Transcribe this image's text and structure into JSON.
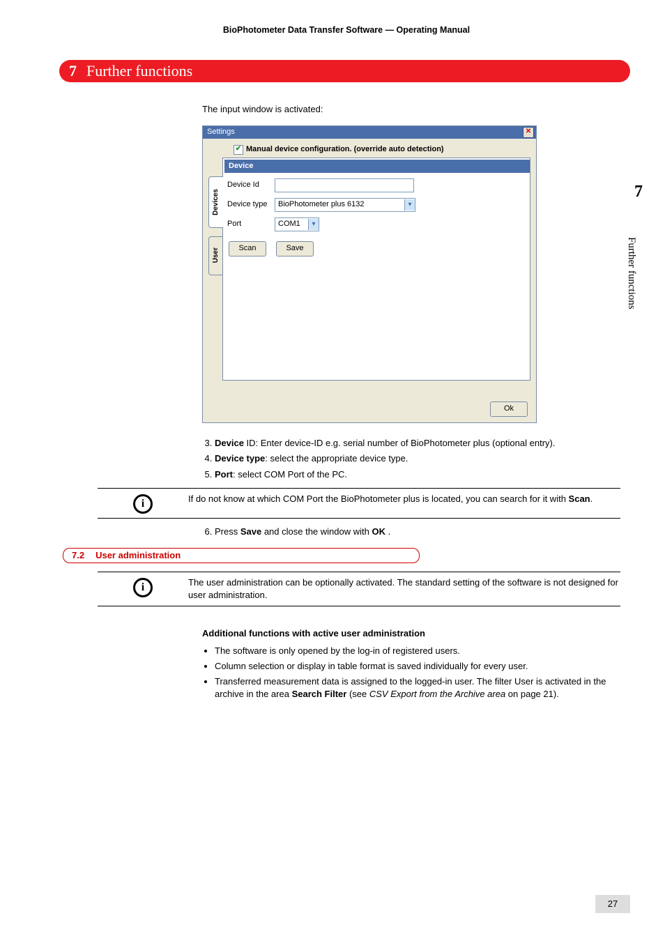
{
  "header": {
    "doc_title": "BioPhotometer Data Transfer Software  —  Operating Manual"
  },
  "chapter": {
    "number": "7",
    "title": "Further functions"
  },
  "intro": {
    "text": "The input window is activated:"
  },
  "dialog": {
    "title": "Settings",
    "close_glyph": "✕",
    "checkbox_check": "✔",
    "checkbox_label": "Manual device configuration.  (override auto detection)",
    "group_header": "Device",
    "labels": {
      "device_id": "Device Id",
      "device_type": "Device type",
      "port": "Port"
    },
    "values": {
      "device_id": "",
      "device_type": "BioPhotometer plus 6132",
      "port": "COM1"
    },
    "buttons": {
      "scan": "Scan",
      "save": "Save",
      "ok": "Ok"
    },
    "tabs": {
      "devices": "Devices",
      "user": "User"
    }
  },
  "steps": {
    "s3_label": "Device",
    "s3_rest": " ID: Enter device-ID e.g. serial number of BioPhotometer plus (optional entry).",
    "s4_label": "Device type",
    "s4_rest": ": select the appropriate device type.",
    "s5_label": "Port",
    "s5_rest": ": select COM Port of the PC."
  },
  "note1": {
    "pre": "If do not know at which COM Port the BioPhotometer plus is located, you can search for it with ",
    "bold": "Scan",
    "post": "."
  },
  "step6": {
    "pre": "Press ",
    "b1": "Save",
    "mid": "  and close the window with ",
    "b2": "OK ",
    "post": "."
  },
  "section": {
    "num": "7.2",
    "title": "User administration"
  },
  "note2": {
    "text": "The user administration can be optionally activated. The standard setting of the software is not designed for user administration."
  },
  "subhead": "Additional functions with active user administration",
  "bullets": {
    "b1": "The software is only opened by the log-in of registered users.",
    "b2": "Column selection or display in table format is saved individually for every user.",
    "b3_pre": "Transferred measurement data is assigned to the logged-in user. The filter User is activated in the archive in the area ",
    "b3_bold": "Search Filter",
    "b3_mid": " (see ",
    "b3_ital": "CSV Export from the Archive area",
    "b3_post": " on page 21)."
  },
  "side": {
    "num": "7",
    "title": "Further functions"
  },
  "footer": {
    "page": "27"
  },
  "info_glyph": "i"
}
